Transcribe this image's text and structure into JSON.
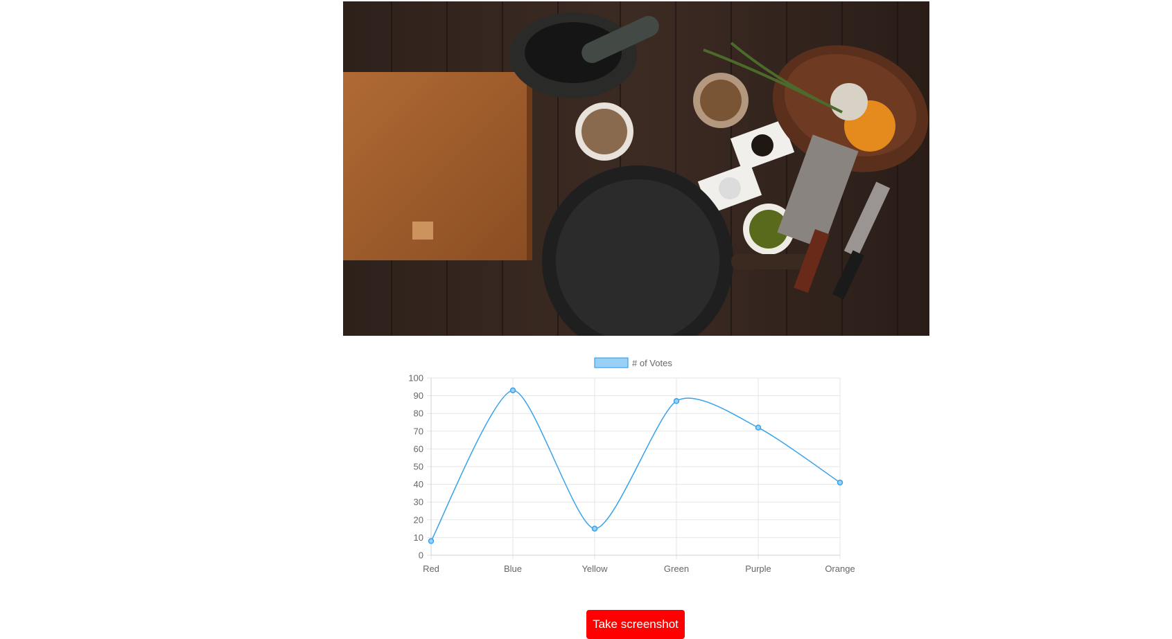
{
  "photo": {
    "description_icon": "kitchen-flatlay-photo"
  },
  "chart_data": {
    "type": "line",
    "categories": [
      "Red",
      "Blue",
      "Yellow",
      "Green",
      "Purple",
      "Orange"
    ],
    "series": [
      {
        "name": "# of Votes",
        "values": [
          8,
          93,
          15,
          87,
          72,
          41
        ],
        "color": "#36a2eb",
        "fill": "#9ad0f5"
      }
    ],
    "ylim": [
      0,
      100
    ],
    "yticks": [
      0,
      10,
      20,
      30,
      40,
      50,
      60,
      70,
      80,
      90,
      100
    ],
    "grid": true,
    "legend_position": "top"
  },
  "actions": {
    "screenshot_label": "Take screenshot",
    "button_color": "#ff0000"
  }
}
